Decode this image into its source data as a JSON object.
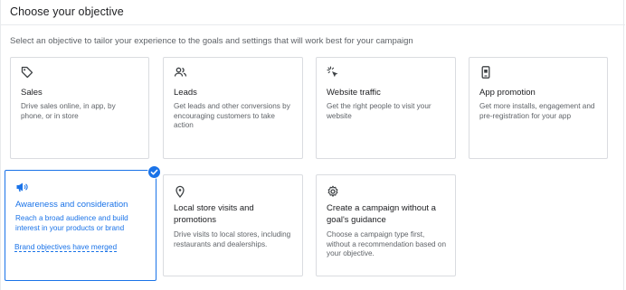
{
  "header": {
    "title": "Choose your objective"
  },
  "subtitle": "Select an objective to tailor your experience to the goals and settings that will work best for your campaign",
  "objectives": [
    {
      "icon": "tag-icon",
      "title": "Sales",
      "description": "Drive sales online, in app, by phone, or in store"
    },
    {
      "icon": "people-icon",
      "title": "Leads",
      "description": "Get leads and other conversions by encouraging customers to take action"
    },
    {
      "icon": "cursor-click-icon",
      "title": "Website traffic",
      "description": "Get the right people to visit your website"
    },
    {
      "icon": "phone-icon",
      "title": "App promotion",
      "description": "Get more installs, engagement and pre-registration for your app"
    },
    {
      "icon": "megaphone-icon",
      "title": "Awareness and consideration",
      "description": "Reach a broad audience and build interest in your products or brand",
      "link": "Brand objectives have merged",
      "selected": true
    },
    {
      "icon": "location-pin-icon",
      "title": "Local store visits and promotions",
      "description": "Drive visits to local stores, including restaurants and dealerships."
    },
    {
      "icon": "gear-icon",
      "title": "Create a campaign without a goal's guidance",
      "description": "Choose a campaign type first, without a recommendation based on your objective."
    }
  ],
  "colors": {
    "accent": "#1a73e8",
    "border": "#dadce0",
    "text": "#202124",
    "muted": "#5f6368"
  }
}
